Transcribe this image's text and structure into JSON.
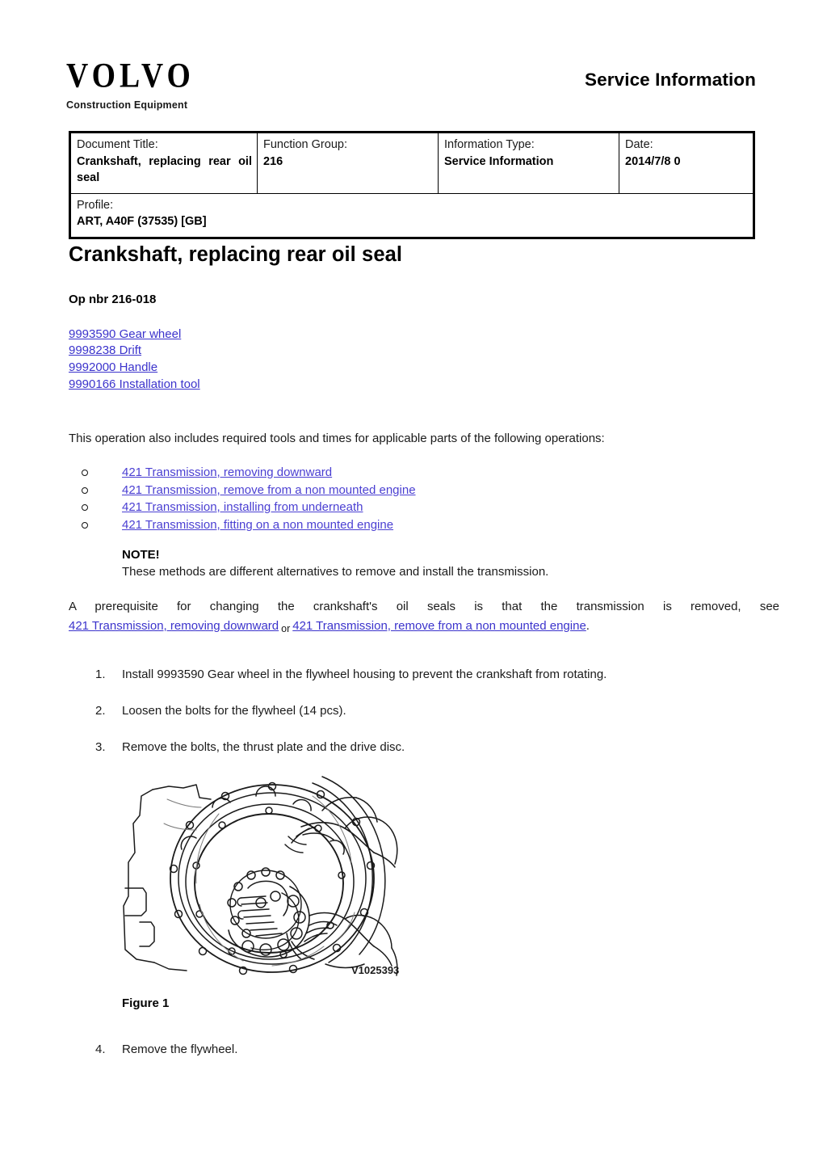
{
  "header": {
    "logo_wordmark": "VOLVO",
    "logo_subtitle": "Construction Equipment",
    "service_information": "Service Information"
  },
  "info_table": {
    "columns": [
      {
        "label": "Document Title:",
        "value": "Crankshaft, replacing rear oil seal"
      },
      {
        "label": "Function Group:",
        "value": "216"
      },
      {
        "label": "Information Type:",
        "value": "Service Information"
      },
      {
        "label": "Date:",
        "value": "2014/7/8 0"
      }
    ],
    "profile": {
      "label": "Profile:",
      "value": "ART, A40F (37535) [GB]"
    }
  },
  "document": {
    "title": "Crankshaft, replacing rear oil seal",
    "op_nbr": "Op nbr 216-018",
    "tool_links": [
      "9993590 Gear wheel",
      "9998238 Drift",
      "9992000 Handle",
      "9990166 Installation tool"
    ],
    "intro_paragraph": "This operation also includes required tools and times for applicable parts of the following operations:",
    "operation_links": [
      "421 Transmission, removing downward",
      "421 Transmission, remove from a non mounted engine",
      "421 Transmission, installing from underneath",
      "421 Transmission, fitting on a non mounted engine"
    ],
    "note_title": "NOTE!",
    "note_text": "These methods are different alternatives to remove and install the transmission.",
    "prerequisite": {
      "line1": "A prerequisite for changing the crankshaft's oil seals is that the transmission is removed, see",
      "link1": "421 Transmission, removing downward",
      "conjunction": "or",
      "link2": "421 Transmission, remove from a non mounted engine",
      "trailing": "."
    },
    "steps": [
      {
        "num": "1.",
        "text": "Install 9993590 Gear wheel in the flywheel housing to prevent the crankshaft from rotating."
      },
      {
        "num": "2.",
        "text": "Loosen the bolts for the flywheel (14 pcs)."
      },
      {
        "num": "3.",
        "text": "Remove the bolts, the thrust plate and the drive disc."
      },
      {
        "num": "4.",
        "text": "Remove the flywheel."
      }
    ],
    "figure": {
      "image_id": "V1025393",
      "caption": "Figure 1",
      "alt": "Line drawing of flywheel housing with hands removing drive disc"
    }
  },
  "colors": {
    "link": "#3b33cc",
    "link_violet": "#4a3fd2",
    "text": "#1a1a1a",
    "border": "#000000"
  }
}
